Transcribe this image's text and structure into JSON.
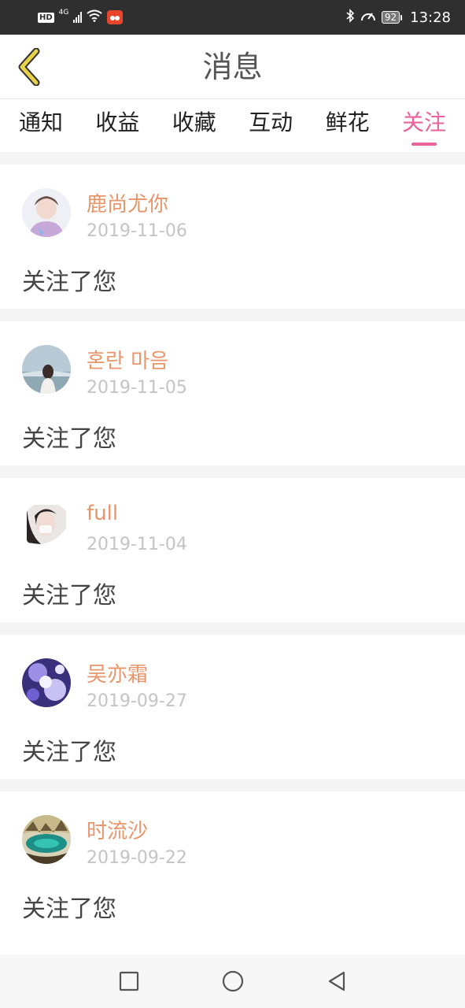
{
  "status_bar": {
    "hd": "HD",
    "network": "4G",
    "battery": "92",
    "time": "13:28"
  },
  "header": {
    "title": "消息",
    "back_icon": "chevron-left-icon",
    "accent_color": "#e8d24a"
  },
  "tabs": [
    {
      "label": "通知",
      "active": false
    },
    {
      "label": "收益",
      "active": false
    },
    {
      "label": "收藏",
      "active": false
    },
    {
      "label": "互动",
      "active": false
    },
    {
      "label": "鲜花",
      "active": false
    },
    {
      "label": "关注",
      "active": true
    }
  ],
  "colors": {
    "active_tab": "#e8629b",
    "username": "#e8956a",
    "date": "#c4c4c4"
  },
  "notifications": [
    {
      "user": "鹿尚尤你",
      "date": "2019-11-06",
      "action": "关注了您"
    },
    {
      "user": "혼란 마음",
      "date": "2019-11-05",
      "action": "关注了您"
    },
    {
      "user": "full",
      "date": "2019-11-04",
      "action": "关注了您"
    },
    {
      "user": "吴亦霜",
      "date": "2019-09-27",
      "action": "关注了您"
    },
    {
      "user": "时流沙",
      "date": "2019-09-22",
      "action": "关注了您"
    }
  ],
  "system_nav": {
    "recent_icon": "square-icon",
    "home_icon": "circle-icon",
    "back_icon": "triangle-back-icon"
  }
}
